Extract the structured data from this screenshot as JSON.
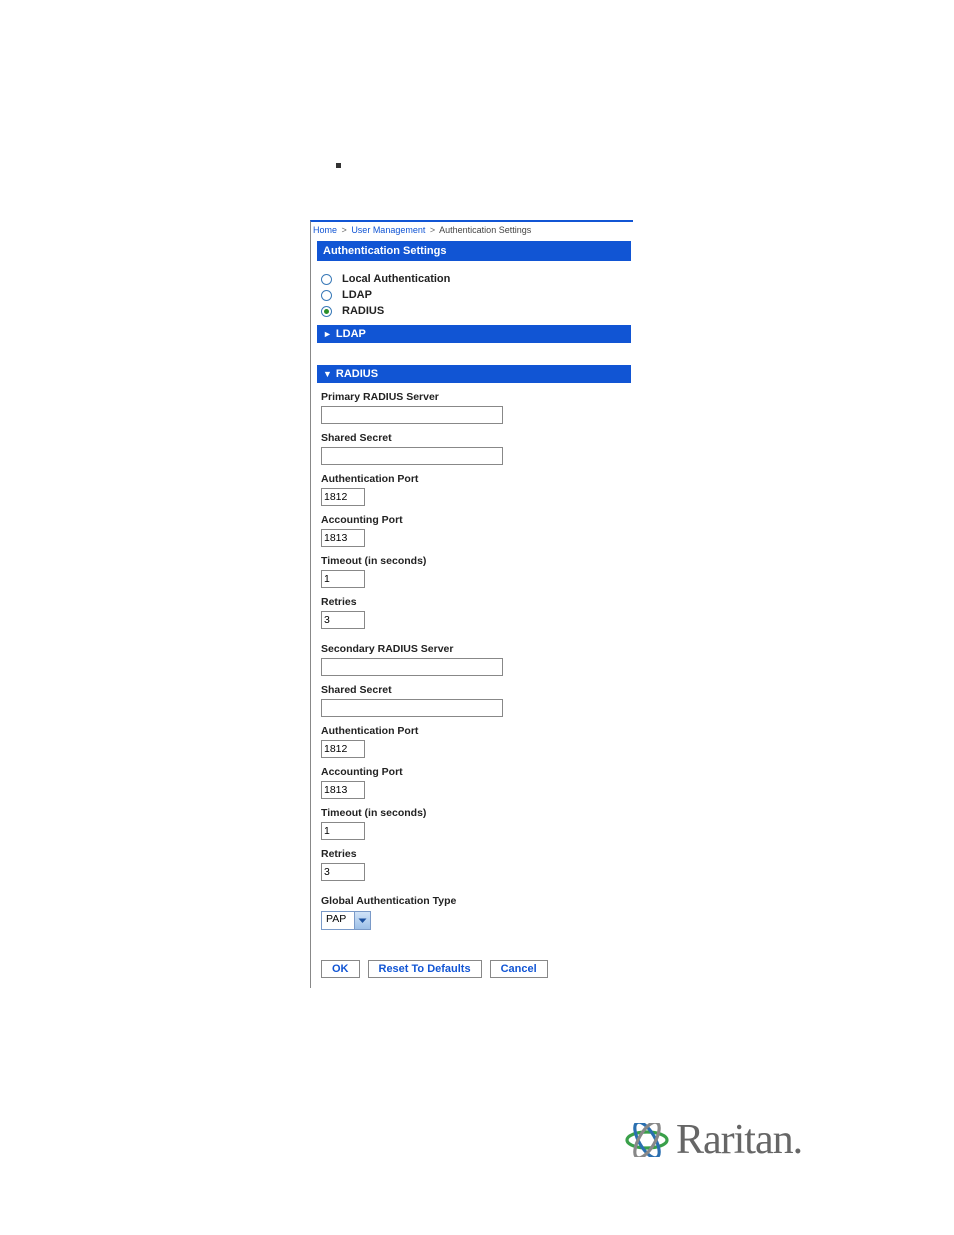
{
  "breadcrumb": {
    "home": "Home",
    "section": "User Management",
    "page": "Authentication Settings"
  },
  "header": {
    "title": "Authentication Settings"
  },
  "auth_options": {
    "local": "Local Authentication",
    "ldap": "LDAP",
    "radius": "RADIUS",
    "selected": "radius"
  },
  "sections": {
    "ldap_label": "LDAP",
    "radius_label": "RADIUS"
  },
  "radius": {
    "primary": {
      "server_label": "Primary RADIUS Server",
      "server_value": "",
      "secret_label": "Shared Secret",
      "secret_value": "",
      "auth_port_label": "Authentication Port",
      "auth_port_value": "1812",
      "acct_port_label": "Accounting Port",
      "acct_port_value": "1813",
      "timeout_label": "Timeout (in seconds)",
      "timeout_value": "1",
      "retries_label": "Retries",
      "retries_value": "3"
    },
    "secondary": {
      "server_label": "Secondary RADIUS Server",
      "server_value": "",
      "secret_label": "Shared Secret",
      "secret_value": "",
      "auth_port_label": "Authentication Port",
      "auth_port_value": "1812",
      "acct_port_label": "Accounting Port",
      "acct_port_value": "1813",
      "timeout_label": "Timeout (in seconds)",
      "timeout_value": "1",
      "retries_label": "Retries",
      "retries_value": "3"
    },
    "global_type_label": "Global Authentication Type",
    "global_type_value": "PAP"
  },
  "buttons": {
    "ok": "OK",
    "reset": "Reset To Defaults",
    "cancel": "Cancel"
  },
  "logo": {
    "brand": "Raritan"
  }
}
